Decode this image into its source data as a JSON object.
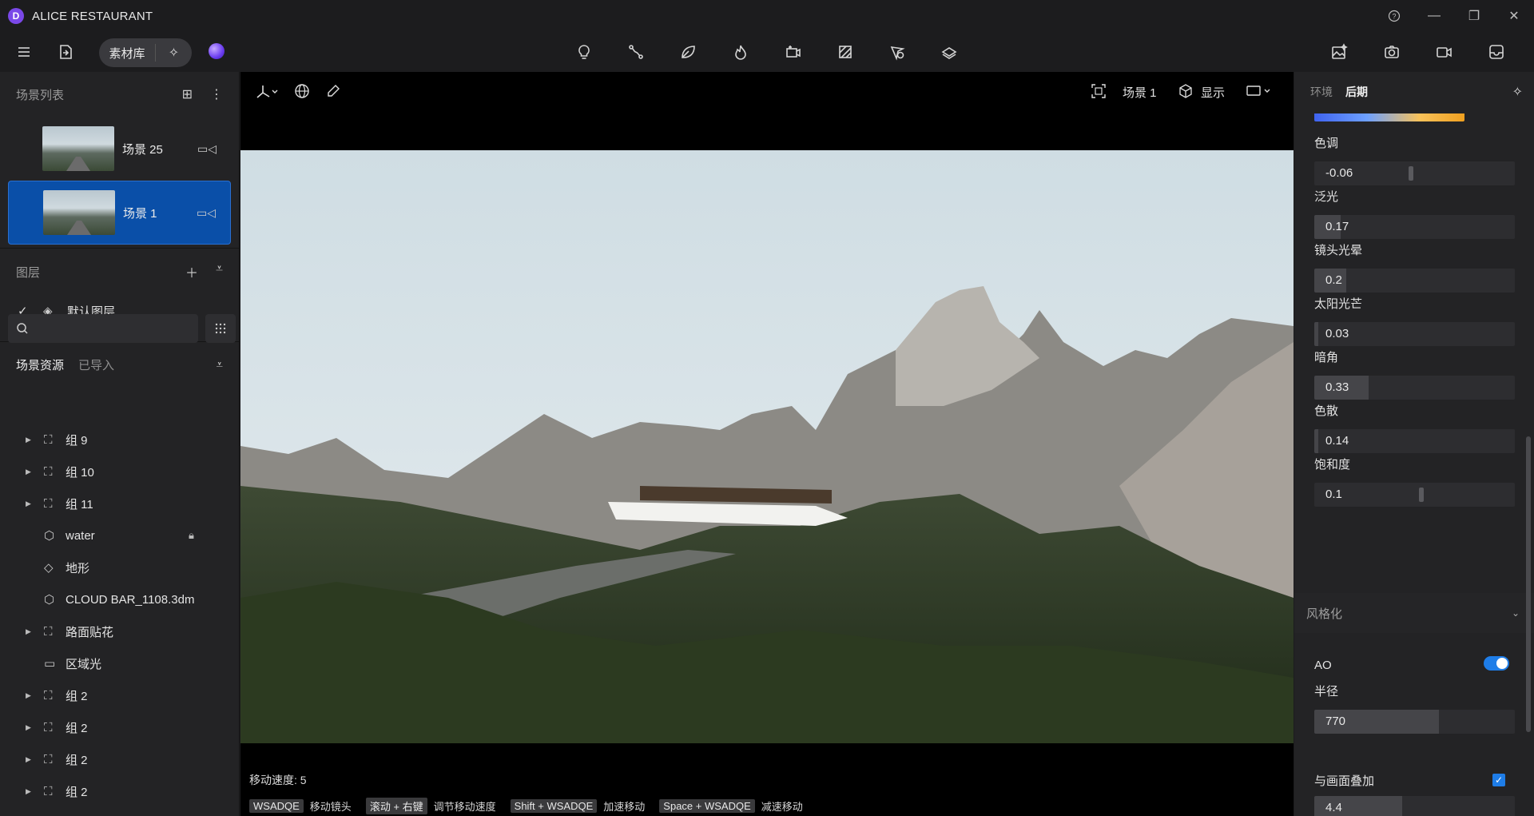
{
  "app": {
    "title": "ALICE RESTAURANT",
    "logo_letter": "D"
  },
  "toolbar": {
    "material_label": "素材库",
    "center_icons": [
      "lightbulb-icon",
      "path-tool-icon",
      "leaf-icon",
      "fire-icon",
      "add-camera-icon",
      "hatch-icon",
      "pin-add-icon",
      "terrain-icon"
    ],
    "right_icons": [
      "image-spark-icon",
      "camera-icon",
      "video-icon",
      "inbox-icon"
    ]
  },
  "left": {
    "scene_list_title": "场景列表",
    "scenes": [
      {
        "name": "场景 25",
        "active": false
      },
      {
        "name": "场景 1",
        "active": true
      }
    ],
    "layers_title": "图层",
    "layers": [
      {
        "name": "默认图层",
        "checked": true
      }
    ],
    "tabs": {
      "assets": "场景资源",
      "imported": "已导入"
    },
    "search_placeholder": "",
    "tree": [
      {
        "name": "组 9",
        "icon": "group-icon",
        "expandable": true,
        "locked": false
      },
      {
        "name": "组 10",
        "icon": "group-icon",
        "expandable": true,
        "locked": false
      },
      {
        "name": "组 11",
        "icon": "group-icon",
        "expandable": true,
        "locked": false
      },
      {
        "name": "water",
        "icon": "cube-icon",
        "expandable": false,
        "locked": true
      },
      {
        "name": "地形",
        "icon": "terrain-icon",
        "expandable": false,
        "locked": false
      },
      {
        "name": "CLOUD BAR_1108.3dm",
        "icon": "cube-icon",
        "expandable": false,
        "locked": false
      },
      {
        "name": "路面贴花",
        "icon": "group-icon",
        "expandable": true,
        "locked": false
      },
      {
        "name": "区域光",
        "icon": "rect-light-icon",
        "expandable": false,
        "locked": false
      },
      {
        "name": "组 2",
        "icon": "group-icon",
        "expandable": true,
        "locked": false
      },
      {
        "name": "组 2",
        "icon": "group-icon",
        "expandable": true,
        "locked": false
      },
      {
        "name": "组 2",
        "icon": "group-icon",
        "expandable": true,
        "locked": false
      },
      {
        "name": "组 2",
        "icon": "group-icon",
        "expandable": true,
        "locked": false
      }
    ]
  },
  "viewport": {
    "scene_label": "场景 1",
    "display_label": "显示",
    "speed_text": "移动速度: 5",
    "hints": [
      {
        "key": "WSADQE",
        "desc": "移动镜头"
      },
      {
        "key": "滚动 + 右键",
        "desc": "调节移动速度"
      },
      {
        "key": "Shift + WSADQE",
        "desc": "加速移动"
      },
      {
        "key": "Space + WSADQE",
        "desc": "减速移动"
      }
    ]
  },
  "right": {
    "tab_env": "环境",
    "tab_post": "后期",
    "params": [
      {
        "label": "色调",
        "value": "-0.06",
        "fill": 0.0,
        "knob": 0.47
      },
      {
        "label": "泛光",
        "value": "0.17",
        "fill": 0.13,
        "knob": null
      },
      {
        "label": "镜头光晕",
        "value": "0.2",
        "fill": 0.16,
        "knob": null
      },
      {
        "label": "太阳光芒",
        "value": "0.03",
        "fill": 0.02,
        "knob": null
      },
      {
        "label": "暗角",
        "value": "0.33",
        "fill": 0.27,
        "knob": null
      },
      {
        "label": "色散",
        "value": "0.14",
        "fill": 0.02,
        "knob": null
      },
      {
        "label": "饱和度",
        "value": "0.1",
        "fill": 0.0,
        "knob": 0.52
      }
    ],
    "stylize_title": "风格化",
    "ao_label": "AO",
    "ao_on": true,
    "radius_label": "半径",
    "radius_value": "770",
    "radius_fill": 0.62,
    "overlay_label": "与画面叠加",
    "overlay_checked": true,
    "overlay_value": "4.4"
  }
}
